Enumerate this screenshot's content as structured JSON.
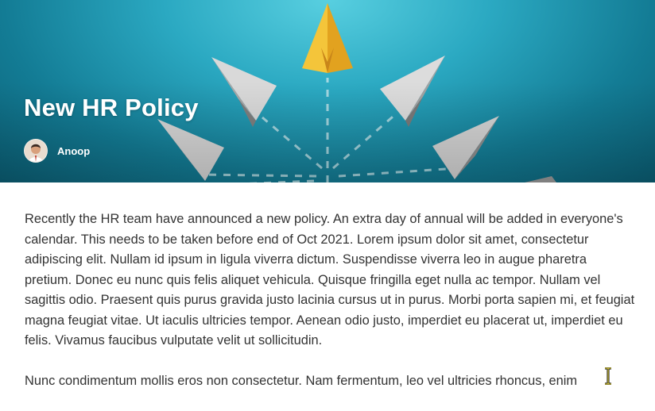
{
  "banner": {
    "title": "New HR Policy",
    "author": "Anoop",
    "colors": {
      "sky_light": "#58cfe0",
      "sky_dark": "#0b5e74",
      "leader_plane": "#f2bb2e",
      "plane_gray": "#9a9a9a"
    }
  },
  "article": {
    "paragraphs": [
      "Recently the HR team have announced a new policy. An extra day of annual will be added in everyone's calendar. This needs to be taken before end of Oct 2021. Lorem ipsum dolor sit amet, consectetur adipiscing elit. Nullam id ipsum in ligula viverra dictum. Suspendisse viverra leo in augue pharetra pretium. Donec eu nunc quis felis aliquet vehicula. Quisque fringilla eget nulla ac tempor. Nullam vel sagittis odio. Praesent quis purus gravida justo lacinia cursus ut in purus. Morbi porta sapien mi, et feugiat magna feugiat vitae. Ut iaculis ultricies tempor. Aenean odio justo, imperdiet eu placerat ut, imperdiet eu felis. Vivamus faucibus vulputate velit ut sollicitudin.",
      "Nunc condimentum mollis eros non consectetur. Nam fermentum, leo vel ultricies rhoncus, enim"
    ]
  },
  "cursor": {
    "type": "text-beam-icon"
  }
}
